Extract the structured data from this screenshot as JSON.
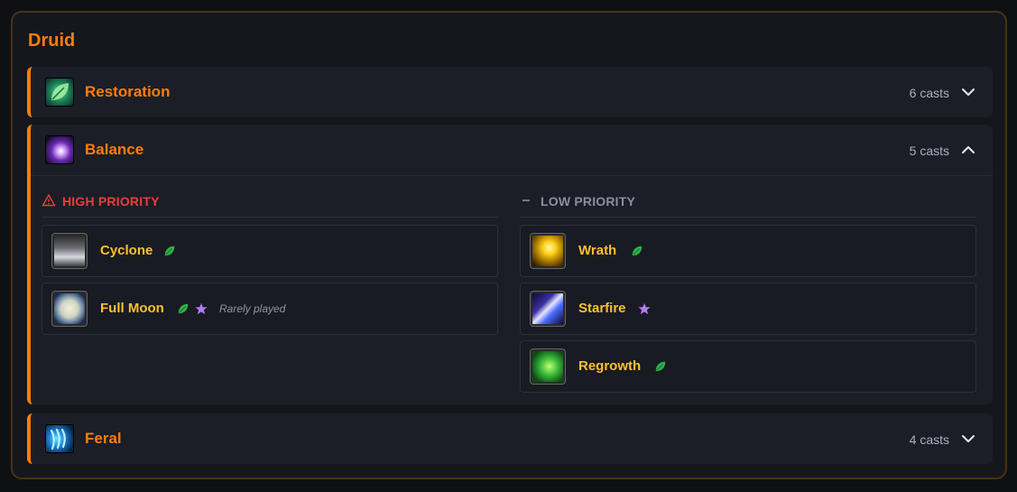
{
  "class_title": "Druid",
  "colors": {
    "class": "#ff7d0a",
    "high_priority": "#ea3c3c",
    "low_priority": "#8a8f9b",
    "spell_name": "#ffc02e",
    "nature_badge": "#2fb34b",
    "star_badge": "#b47cf0"
  },
  "specs": [
    {
      "name": "Restoration",
      "casts": "6 casts",
      "icon": "restoration-leaf-icon",
      "expanded": false
    },
    {
      "name": "Balance",
      "casts": "5 casts",
      "icon": "balance-moonfire-icon",
      "expanded": true
    },
    {
      "name": "Feral",
      "casts": "4 casts",
      "icon": "feral-claw-icon",
      "expanded": false
    }
  ],
  "balance": {
    "high_priority": {
      "label": "HIGH PRIORITY",
      "icon": "warning-triangle-icon",
      "spells": [
        {
          "name": "Cyclone",
          "icon": "cyclone-icon",
          "badges": [
            "leaf-icon"
          ]
        },
        {
          "name": "Full Moon",
          "icon": "full-moon-icon",
          "badges": [
            "leaf-icon",
            "star-icon"
          ],
          "note": "Rarely played"
        }
      ]
    },
    "low_priority": {
      "label": "LOW PRIORITY",
      "icon": "minus-icon",
      "spells": [
        {
          "name": "Wrath",
          "icon": "wrath-icon",
          "badges": [
            "leaf-icon"
          ]
        },
        {
          "name": "Starfire",
          "icon": "starfire-icon",
          "badges": [
            "star-icon"
          ]
        },
        {
          "name": "Regrowth",
          "icon": "regrowth-icon",
          "badges": [
            "leaf-icon"
          ]
        }
      ]
    }
  }
}
